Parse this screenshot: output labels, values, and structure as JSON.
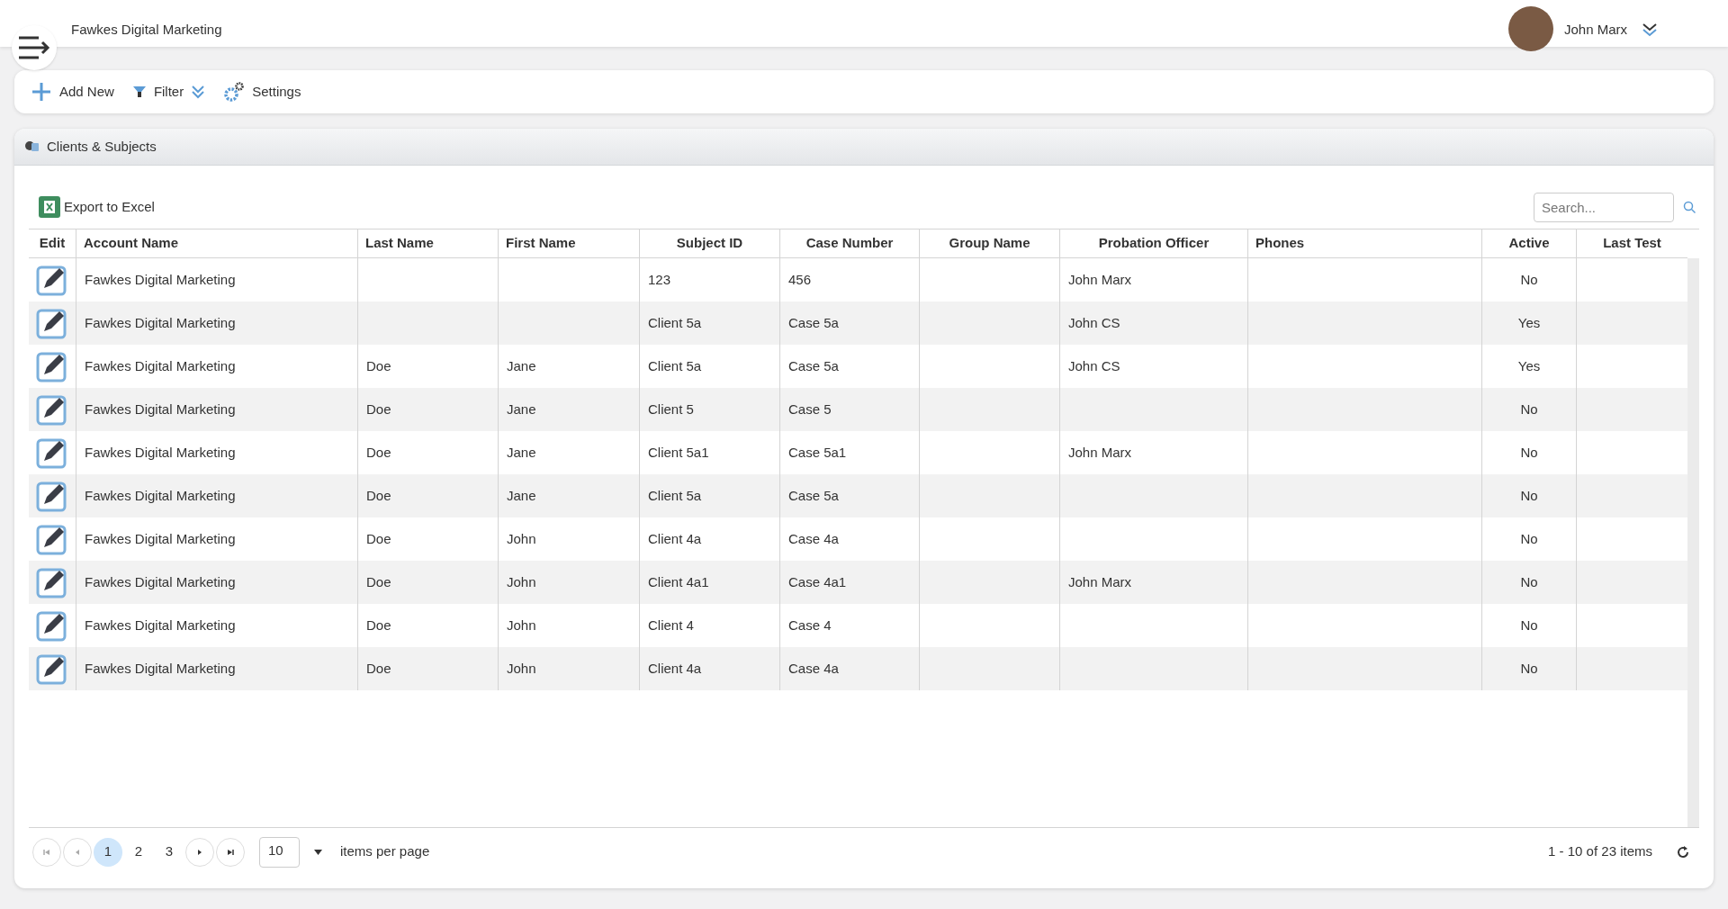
{
  "header": {
    "title": "Fawkes Digital Marketing",
    "user_name": "John Marx"
  },
  "toolbar": [
    {
      "kind": "add",
      "label": "Add New"
    },
    {
      "kind": "filter",
      "label": "Filter"
    },
    {
      "kind": "settings",
      "label": "Settings"
    }
  ],
  "panel": {
    "title": "Clients & Subjects",
    "export_label": "Export to Excel",
    "search": {
      "placeholder": "Search..."
    }
  },
  "table": {
    "columns": [
      "Edit",
      "Account Name",
      "Last Name",
      "First Name",
      "Subject ID",
      "Case Number",
      "Group Name",
      "Probation Officer",
      "Phones",
      "Active",
      "Last Test"
    ],
    "rows": [
      [
        "",
        "Fawkes Digital Marketing",
        "",
        "",
        "123",
        "456",
        "",
        "John Marx",
        "",
        "No",
        ""
      ],
      [
        "",
        "Fawkes Digital Marketing",
        "",
        "",
        "Client 5a",
        "Case 5a",
        "",
        "John CS",
        "",
        "Yes",
        ""
      ],
      [
        "",
        "Fawkes Digital Marketing",
        "Doe",
        "Jane",
        "Client 5a",
        "Case 5a",
        "",
        "John CS",
        "",
        "Yes",
        ""
      ],
      [
        "",
        "Fawkes Digital Marketing",
        "Doe",
        "Jane",
        "Client 5",
        "Case 5",
        "",
        "",
        "",
        "No",
        ""
      ],
      [
        "",
        "Fawkes Digital Marketing",
        "Doe",
        "Jane",
        "Client 5a1",
        "Case 5a1",
        "",
        "John Marx",
        "",
        "No",
        ""
      ],
      [
        "",
        "Fawkes Digital Marketing",
        "Doe",
        "Jane",
        "Client 5a",
        "Case 5a",
        "",
        "",
        "",
        "No",
        ""
      ],
      [
        "",
        "Fawkes Digital Marketing",
        "Doe",
        "John",
        "Client 4a",
        "Case 4a",
        "",
        "",
        "",
        "No",
        ""
      ],
      [
        "",
        "Fawkes Digital Marketing",
        "Doe",
        "John",
        "Client 4a1",
        "Case 4a1",
        "",
        "John Marx",
        "",
        "No",
        ""
      ],
      [
        "",
        "Fawkes Digital Marketing",
        "Doe",
        "John",
        "Client 4",
        "Case 4",
        "",
        "",
        "",
        "No",
        ""
      ],
      [
        "",
        "Fawkes Digital Marketing",
        "Doe",
        "John",
        "Client 4a",
        "Case 4a",
        "",
        "",
        "",
        "No",
        ""
      ]
    ]
  },
  "pager": {
    "pages": [
      {
        "label": "1",
        "selected": true
      },
      {
        "label": "2",
        "selected": false
      },
      {
        "label": "3",
        "selected": false
      }
    ],
    "page_size": "10",
    "page_size_label": "items per page",
    "summary": "1 - 10 of 23 items"
  }
}
